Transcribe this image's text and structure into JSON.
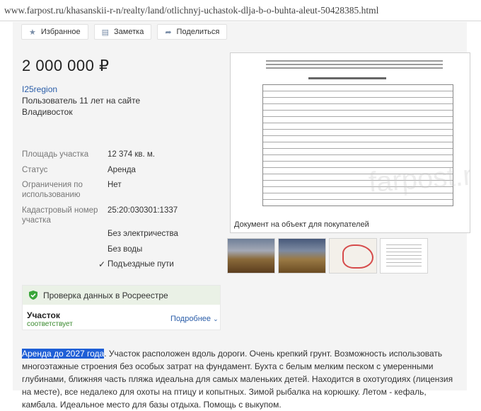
{
  "url": "www.farpost.ru/khasanskii-r-n/realty/land/otlichnyj-uchastok-dlja-b-o-buhta-aleut-50428385.html",
  "toolbar": {
    "favorite": "Избранное",
    "note": "Заметка",
    "share": "Поделиться"
  },
  "listing": {
    "price": "2 000 000 ₽",
    "seller": "I25region",
    "member_since": "Пользователь 11 лет на сайте",
    "city": "Владивосток"
  },
  "attributes": [
    {
      "label": "Площадь участка",
      "value": "12 374 кв. м."
    },
    {
      "label": "Статус",
      "value": "Аренда"
    },
    {
      "label": "Ограничения по использованию",
      "value": "Нет"
    },
    {
      "label": "Кадастровый номер участка",
      "value": "25:20:030301:1337"
    }
  ],
  "features": {
    "electricity": "Без электричества",
    "water": "Без воды",
    "roads": "Подъездные пути"
  },
  "document": {
    "caption": "Документ на объект для покупателей",
    "watermark": "farpost.ru"
  },
  "verification": {
    "title": "Проверка данных в Росреестре",
    "item": "Участок",
    "status": "соответствует",
    "more": "Подробнее"
  },
  "description": {
    "highlight": "Аренда до 2027 года",
    "text": ". Участок расположен вдоль дороги. Очень крепкий грунт. Возможность использовать многоэтажные строения без особых затрат на фундамент. Бухта с белым мелким песком с умеренными глубинами, ближняя часть пляжа идеальна для самых маленьких детей. Находится в охотугодиях (лицензия на месте), все недалеко для охоты на птицу и копытных. Зимой рыбалка на корюшку. Летом - кефаль, камбала. Идеальное место для базы отдыха. Помощь с выкупом."
  },
  "colors": {
    "link": "#2a5da8",
    "verified": "#3a8a2e",
    "highlight": "#1f5fd6"
  }
}
